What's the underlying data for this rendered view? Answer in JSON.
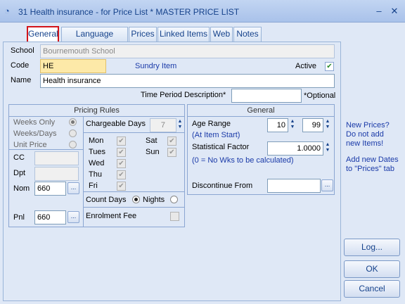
{
  "window": {
    "title": "31 Health insurance - for Price List * MASTER PRICE LIST",
    "minimize": "–",
    "close": "✕"
  },
  "tabs": [
    {
      "label": "General"
    },
    {
      "label": "Language Names"
    },
    {
      "label": "Prices"
    },
    {
      "label": "Linked Items"
    },
    {
      "label": "Web"
    },
    {
      "label": "Notes"
    }
  ],
  "form": {
    "school_label": "School",
    "school_value": "Bournemouth School",
    "code_label": "Code",
    "code_value": "HE",
    "sundry_text": "Sundry Item",
    "active_label": "Active",
    "name_label": "Name",
    "name_value": "Health insurance",
    "tpd_label": "Time Period Description*",
    "tpd_value": "",
    "optional_text": "*Optional"
  },
  "pricing_rules": {
    "title": "Pricing Rules",
    "weeks_only": "Weeks Only",
    "weeks_days": "Weeks/Days",
    "unit_price": "Unit Price",
    "cc_label": "CC",
    "dpt_label": "Dpt",
    "nom_label": "Nom",
    "nom_value": "660",
    "pnl_label": "Pnl",
    "pnl_value": "660",
    "browse": "...",
    "chargeable_days_label": "Chargeable Days",
    "chargeable_days_value": "7",
    "days": {
      "mon": "Mon",
      "tues": "Tues",
      "wed": "Wed",
      "thu": "Thu",
      "fri": "Fri",
      "sat": "Sat",
      "sun": "Sun"
    },
    "count_days_label": "Count Days",
    "nights_label": "Nights",
    "enrolment_fee_label": "Enrolment Fee"
  },
  "general_panel": {
    "title": "General",
    "age_range_label": "Age Range",
    "age_from": "10",
    "age_to": "99",
    "at_item_start": "(At Item Start)",
    "stat_factor_label": "Statistical Factor",
    "stat_factor_value": "1.0000",
    "stat_note": "(0 = No  Wks to be calculated)",
    "discontinue_label": "Discontinue From",
    "discontinue_value": "",
    "browse": "..."
  },
  "side": {
    "note1_l1": "New Prices?",
    "note1_l2": "Do not add",
    "note1_l3": "new Items!",
    "note2_l1": "Add new Dates",
    "note2_l2": "to \"Prices\" tab",
    "log_button": "Log...",
    "ok_button": "OK",
    "cancel_button": "Cancel"
  },
  "colors": {
    "titlebar_text": "#15428b",
    "active_tab_border": "#d2131a",
    "link_blue": "#1a3aa8",
    "code_field": "#fde9a8"
  }
}
